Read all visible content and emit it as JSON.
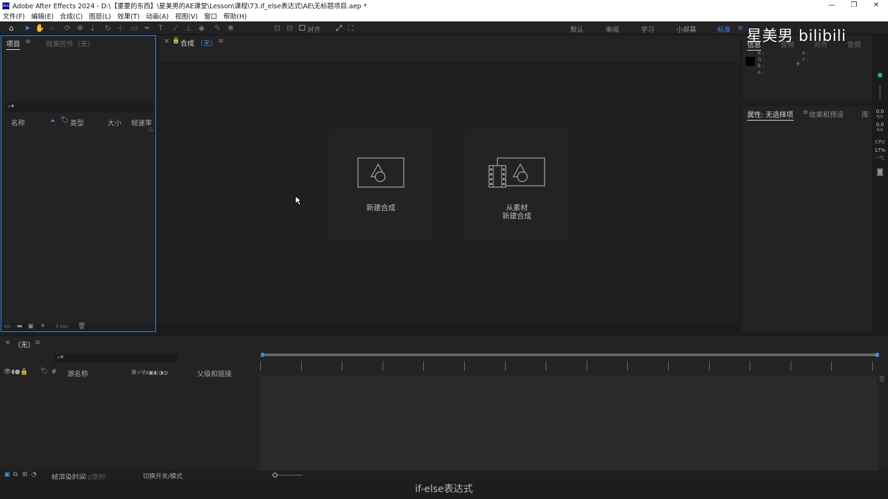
{
  "window": {
    "title": "Adobe After Effects 2024 - D:\\【重要的东西】\\星美男的AE课堂\\Lesson\\课程\\73.if_else表达式\\AE\\无标题项目.aep *",
    "app_icon": "Ae",
    "controls": {
      "minimize": "—",
      "restore": "❐",
      "close": "✕"
    }
  },
  "menu": [
    "文件(F)",
    "编辑(E)",
    "合成(C)",
    "图层(L)",
    "效果(T)",
    "动画(A)",
    "视图(V)",
    "窗口",
    "帮助(H)"
  ],
  "toolbar": {
    "align_label": "对齐",
    "workspaces": [
      "默认",
      "审阅",
      "学习",
      "小屏幕",
      "标准"
    ],
    "active_workspace": "标准",
    "workspace_menu": "≡"
  },
  "project_panel": {
    "tab_project": "项目",
    "tab_menu": "≡",
    "tab_effects": "效果控件（无）",
    "search_placeholder": "",
    "columns": {
      "name": "名称",
      "type": "类型",
      "size": "大小",
      "fps": "帧速率"
    },
    "bpc": "8 bpc"
  },
  "comp_panel": {
    "close": "×",
    "tab_label": "合成",
    "tab_suffix": "（无）",
    "tab_menu": "≡",
    "new_comp_label": "新建合成",
    "from_footage_line1": "从素材",
    "from_footage_line2": "新建合成"
  },
  "info_panel": {
    "tabs": [
      "信息",
      "音频",
      "对齐",
      "音频"
    ],
    "r": "R :",
    "g": "G :",
    "b": "B :",
    "a": "A :",
    "x": "X :",
    "y": "Y :"
  },
  "effects_panel": {
    "tab_properties": "属性: 无选择项",
    "tab_menu": "≡",
    "tab_effects": "效果和预设",
    "tab_library": "库"
  },
  "right_strip": {
    "up_value": "0.0",
    "up_unit": "K/s",
    "down_value": "0.0",
    "down_unit": "K/s",
    "cpu_label": "CPU",
    "cpu_value": "17%",
    "temp": "--℃"
  },
  "watermark": "星美男 bilibili",
  "timeline": {
    "close": "×",
    "tab_label": "（无）",
    "tab_menu": "≡",
    "search_placeholder": "",
    "source_name_col": "源名称",
    "hash_col": "#",
    "parent_col": "父级和链接",
    "switch_icons": "单✧\\fx▣◐◑◎",
    "render_time": "帧渲染时间",
    "render_value": "0毫秒",
    "toggle_label": "切换开关/模式"
  },
  "subtitle": "if-else表达式",
  "colors": {
    "accent_blue": "#2d8ceb",
    "workspace_active": "#3f8eea",
    "panel_bg": "#232323",
    "status_green": "#21b073"
  }
}
